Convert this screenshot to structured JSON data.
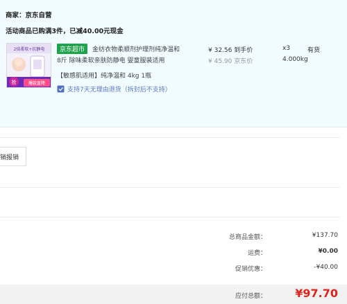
{
  "store": {
    "merchant": "商家：京东自营",
    "promo": "活动商品已购满3件，已减40.00元现金"
  },
  "item": {
    "thumb_text_1": "2倍柔软+抗静电",
    "thumb_text_2": "抢",
    "thumb_text_3": "爆款直降",
    "tag": "京东超市",
    "title_line1": "金纺衣物柔顺剂护理剂纯净温和",
    "title_line2": "8斤 除味柔软亲肤防静电 婴童服装适用",
    "spec": "【敏感肌适用】纯净温和 4kg 1瓶",
    "service": "支持7天无理由退货（拆封后不支持）",
    "price": "¥ 32.56 到手价",
    "orig_price": "¥ 45.90 京东价",
    "qty": "x3",
    "stock": "有货",
    "weight": "4.000kg"
  },
  "invoice": {
    "label": "销报销"
  },
  "summary": {
    "goods_label": "总商品金额：",
    "goods_value": "¥137.70",
    "freight_label": "运费：",
    "freight_value": "¥0.00",
    "discount_label": "促销优惠：",
    "discount_value": "-¥40.00",
    "total_label": "应付总额：",
    "total_value": "¥97.70"
  },
  "colors": {
    "jd_green": "#1ea24a",
    "price_red": "#e2231a",
    "service_blue": "#5a78c8",
    "panel_bg": "#f2fbff"
  }
}
